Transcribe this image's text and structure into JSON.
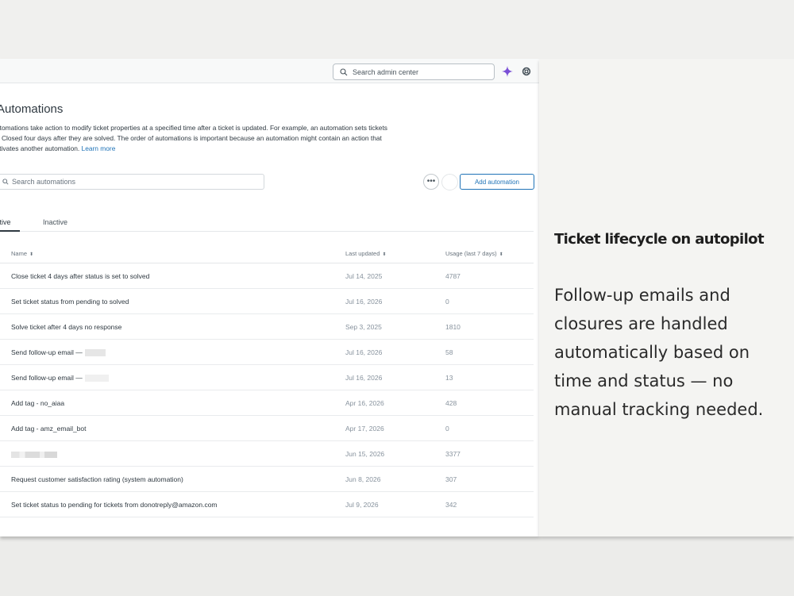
{
  "topbar": {
    "search_placeholder": "Search admin center"
  },
  "page": {
    "title": "Automations",
    "description_lines": [
      "utomations take action to modify ticket properties at a specified time after a ticket is updated. For example, an automation sets tickets",
      "o Closed four days after they are solved. The order of automations is important because an automation might contain an action that",
      "ctivates another automation."
    ],
    "learn_more": "Learn more",
    "search_placeholder": "Search automations",
    "more_label": "•••",
    "add_button": "Add automation"
  },
  "tabs": [
    {
      "label": "ctive",
      "active": true
    },
    {
      "label": "Inactive",
      "active": false
    }
  ],
  "table": {
    "columns": {
      "name": "Name",
      "updated": "Last updated",
      "usage": "Usage (last 7 days)",
      "sort_glyph": "⬍"
    },
    "rows": [
      {
        "name": "Close ticket 4 days after status is set to solved",
        "updated": "Jul 14, 2025",
        "usage": "4787"
      },
      {
        "name": "Set ticket status from pending to solved",
        "updated": "Jul 16, 2026",
        "usage": "0"
      },
      {
        "name": "Solve ticket after 4 days no response",
        "updated": "Sep 3, 2025",
        "usage": "1810"
      },
      {
        "name": "Send follow-up email —",
        "updated": "Jul 16, 2026",
        "usage": "58"
      },
      {
        "name": "Send follow-up email —",
        "updated": "Jul 16, 2026",
        "usage": "13"
      },
      {
        "name": "Add tag - no_aiaa",
        "updated": "Apr 16, 2026",
        "usage": "428"
      },
      {
        "name": "Add tag - amz_email_bot",
        "updated": "Apr 17, 2026",
        "usage": "0"
      },
      {
        "name": "",
        "updated": "Jun 15, 2026",
        "usage": "3377"
      },
      {
        "name": "Request customer satisfaction rating (system automation)",
        "updated": "Jun 8, 2026",
        "usage": "307"
      },
      {
        "name": "Set ticket status to pending for tickets from donotreply@amazon.com",
        "updated": "Jul 9, 2026",
        "usage": "342"
      }
    ]
  },
  "promo": {
    "headline": "Ticket lifecycle on autopilot",
    "body": "Follow-up emails and closures are handled automatically based on time and status — no manual tracking needed."
  },
  "colors": {
    "accent": "#1f73b7",
    "sparkle": "#7a4fd6",
    "text": "#2f3941",
    "muted": "#87929d"
  },
  "icons": {
    "admin_search": "search-icon",
    "ai": "sparkle-icon",
    "help": "help-ring-icon",
    "automation_search": "search-icon"
  }
}
